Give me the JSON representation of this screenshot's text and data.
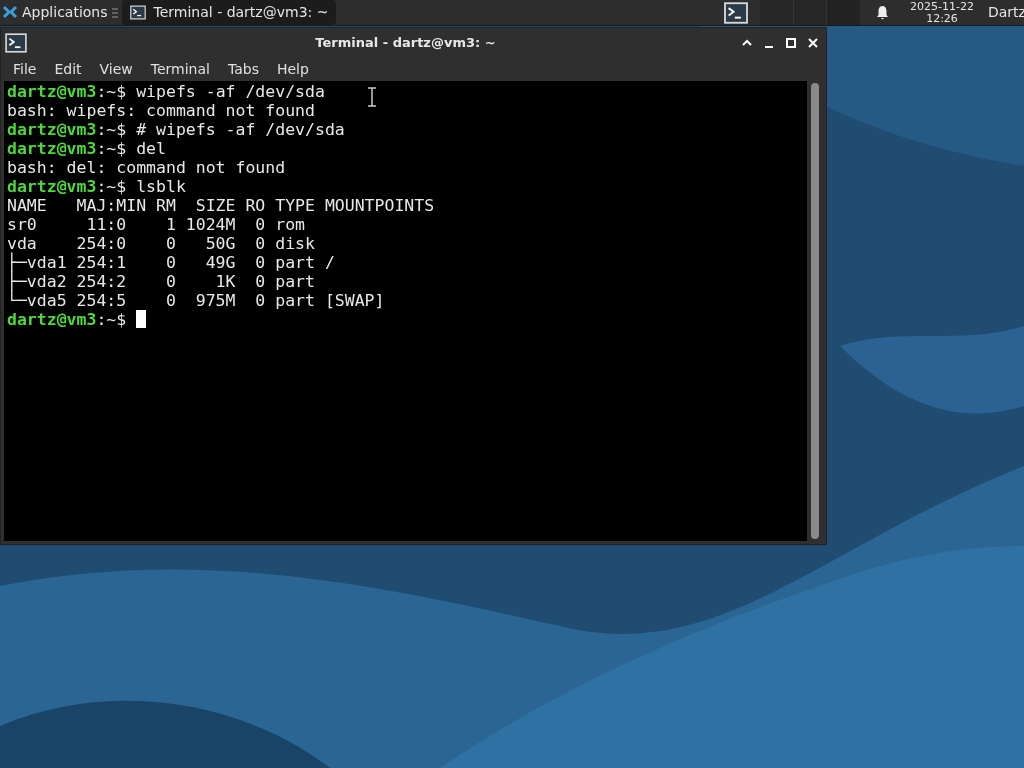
{
  "panel": {
    "applications_label": "Applications",
    "tasks": [
      {
        "title": "Terminal - dartz@vm3: ~",
        "selected": true
      }
    ],
    "clock_date": "2025-11-22",
    "clock_time": "12:26",
    "user": "Dartz"
  },
  "window": {
    "title": "Terminal - dartz@vm3: ~",
    "menu": [
      "File",
      "Edit",
      "View",
      "Terminal",
      "Tabs",
      "Help"
    ]
  },
  "terminal": {
    "lines": [
      {
        "kind": "prompt",
        "user": "dartz@vm3",
        "path": ":~$ ",
        "command": "wipefs -af /dev/sda"
      },
      {
        "kind": "output",
        "text": "bash: wipefs: command not found"
      },
      {
        "kind": "prompt",
        "user": "dartz@vm3",
        "path": ":~$ ",
        "command": "# wipefs -af /dev/sda"
      },
      {
        "kind": "prompt",
        "user": "dartz@vm3",
        "path": ":~$ ",
        "command": "del"
      },
      {
        "kind": "output",
        "text": "bash: del: command not found"
      },
      {
        "kind": "prompt",
        "user": "dartz@vm3",
        "path": ":~$ ",
        "command": "lsblk"
      },
      {
        "kind": "output",
        "text": "NAME   MAJ:MIN RM  SIZE RO TYPE MOUNTPOINTS"
      },
      {
        "kind": "output",
        "text": "sr0     11:0    1 1024M  0 rom"
      },
      {
        "kind": "output",
        "text": "vda    254:0    0   50G  0 disk"
      },
      {
        "kind": "output",
        "text": "├─vda1 254:1    0   49G  0 part /"
      },
      {
        "kind": "output",
        "text": "├─vda2 254:2    0    1K  0 part"
      },
      {
        "kind": "output",
        "text": "└─vda5 254:5    0  975M  0 part [SWAP]"
      },
      {
        "kind": "prompt",
        "user": "dartz@vm3",
        "path": ":~$ ",
        "cursor": true
      }
    ]
  }
}
